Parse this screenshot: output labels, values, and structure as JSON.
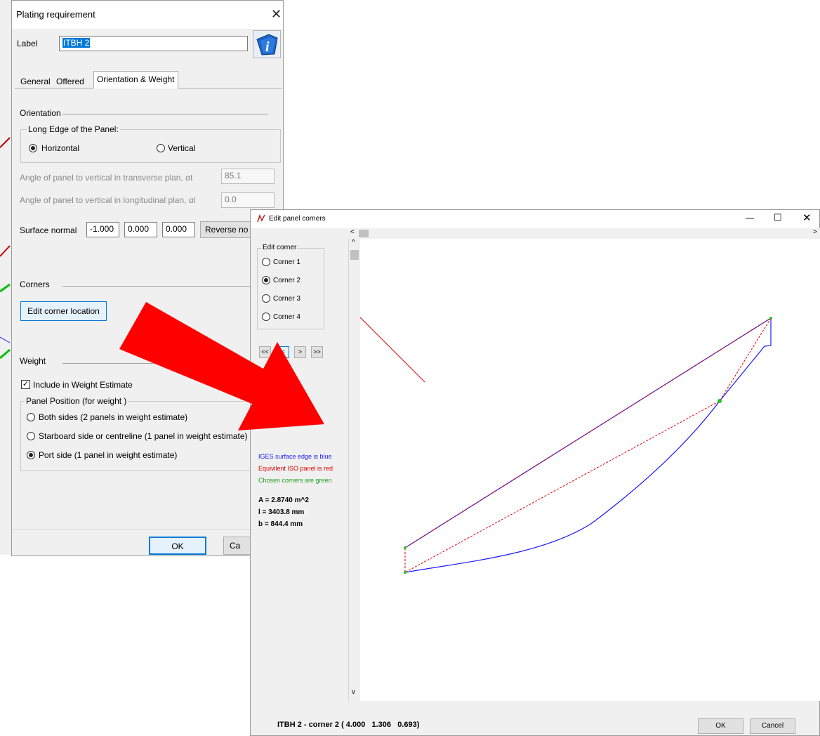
{
  "plating_dialog": {
    "title": "Plating requirement",
    "close_glyph": "✕",
    "label_caption": "Label",
    "label_value": "ITBH 2",
    "info_icon": "info-book-icon",
    "tabs": [
      "General",
      "Offered",
      "Orientation & Weight"
    ],
    "active_tab": "Orientation & Weight",
    "orientation": {
      "heading": "Orientation",
      "group_title": "Long Edge of the Panel:",
      "options": [
        "Horizontal",
        "Vertical"
      ],
      "selected": "Horizontal",
      "angle_transverse_label": "Angle of panel to vertical in transverse plan, αt",
      "angle_transverse_value": "85.1",
      "angle_longitudinal_label": "Angle of panel to vertical in longitudinal plan, αl",
      "angle_longitudinal_value": "0.0",
      "surface_normal_label": "Surface normal",
      "surface_normal_values": [
        "-1.000",
        "0.000",
        "0.000"
      ],
      "reverse_button": "Reverse no"
    },
    "corners": {
      "heading": "Corners",
      "edit_button": "Edit corner location"
    },
    "weight": {
      "heading": "Weight",
      "include_label": "Include in Weight Estimate",
      "include_checked": true,
      "group_title": "Panel Position (for weight )",
      "options": [
        "Both sides (2 panels in weight estimate)",
        "Starboard side or centreline (1 panel in weight estimate)",
        "Port side (1 panel in weight estimate)"
      ],
      "selected": "Port side (1 panel in weight estimate)"
    },
    "ok_button": "OK",
    "cancel_button": "Ca"
  },
  "edit_window": {
    "title": "Edit panel corners",
    "app_icon": "curve-icon",
    "minimize_glyph": "—",
    "maximize_glyph": "☐",
    "close_glyph": "✕",
    "edit_corner_group": "Edit corner",
    "corners": [
      "Corner 1",
      "Corner 2",
      "Corner 3",
      "Corner 4"
    ],
    "selected_corner": "Corner 2",
    "nav_buttons": [
      "<<",
      "<",
      ">",
      ">>"
    ],
    "legend": {
      "blue": "IGES surface edge is blue",
      "red": "Equivilent ISO panel is red",
      "green": "Chosen corners are green"
    },
    "stats": [
      "A = 2.8740 m^2",
      "l = 3403.8 mm",
      "b = 844.4 mm"
    ],
    "status_text": "ITBH 2 - corner 2 ( 4.000   1.306   0.693)",
    "ok_button": "OK",
    "cancel_button": "Cancel"
  },
  "colors": {
    "iges_edge": "#1a1aff",
    "iso_panel": "#e00000",
    "chosen_corner": "#22c422",
    "arrow": "#ff0000"
  }
}
